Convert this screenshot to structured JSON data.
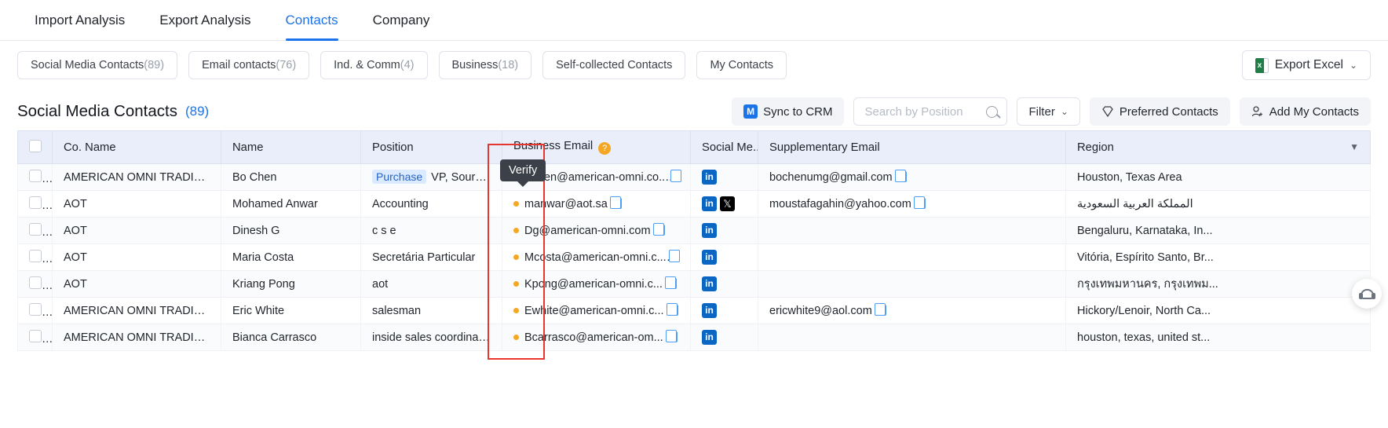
{
  "nav": {
    "tabs": [
      {
        "label": "Import Analysis",
        "active": false
      },
      {
        "label": "Export Analysis",
        "active": false
      },
      {
        "label": "Contacts",
        "active": true
      },
      {
        "label": "Company",
        "active": false
      }
    ]
  },
  "chips": [
    {
      "label": "Social Media Contacts",
      "count": "(89)"
    },
    {
      "label": "Email contacts",
      "count": "(76)"
    },
    {
      "label": "Ind. & Comm",
      "count": "(4)"
    },
    {
      "label": "Business",
      "count": "(18)"
    },
    {
      "label": "Self-collected Contacts",
      "count": ""
    },
    {
      "label": "My Contacts",
      "count": ""
    }
  ],
  "export": {
    "label": "Export Excel",
    "caret": "⌄",
    "icon": "excel-icon"
  },
  "section": {
    "title": "Social Media Contacts",
    "count": "(89)"
  },
  "actions": {
    "sync_label": "Sync to CRM",
    "search_placeholder": "Search by Position",
    "search_value": "",
    "filter_label": "Filter",
    "filter_caret": "⌄",
    "preferred_label": "Preferred Contacts",
    "add_label": "Add My Contacts"
  },
  "tooltip": {
    "text": "Verify"
  },
  "table": {
    "columns": [
      "Co. Name",
      "Name",
      "Position",
      "Business Email",
      "Social Me...",
      "Supplementary Email",
      "Region"
    ],
    "rows": [
      {
        "company": "AMERICAN OMNI TRADING",
        "name": "Bo Chen",
        "position_tag": "Purchase",
        "position": "VP, Sourcing an...",
        "email": "Bchen@american-omni.co...",
        "social": [
          "linkedin"
        ],
        "supplementary": "bochenumg@gmail.com",
        "region": "Houston, Texas Area"
      },
      {
        "company": "AOT",
        "name": "Mohamed Anwar",
        "position_tag": "",
        "position": "Accounting",
        "email": "manwar@aot.sa",
        "social": [
          "linkedin",
          "x"
        ],
        "supplementary": "moustafagahin@yahoo.com",
        "region": "المملكة العربية السعودية"
      },
      {
        "company": "AOT",
        "name": "Dinesh G",
        "position_tag": "",
        "position": "c s e",
        "email": "Dg@american-omni.com",
        "social": [
          "linkedin"
        ],
        "supplementary": "",
        "region": "Bengaluru, Karnataka, In..."
      },
      {
        "company": "AOT",
        "name": "Maria Costa",
        "position_tag": "",
        "position": "Secretária Particular",
        "email": "Mcosta@american-omni.c...",
        "social": [
          "linkedin"
        ],
        "supplementary": "",
        "region": "Vitória, Espírito Santo, Br..."
      },
      {
        "company": "AOT",
        "name": "Kriang Pong",
        "position_tag": "",
        "position": "aot",
        "email": "Kpong@american-omni.c...",
        "social": [
          "linkedin"
        ],
        "supplementary": "",
        "region": "กรุงเทพมหานคร, กรุงเทพม..."
      },
      {
        "company": "AMERICAN OMNI TRADING CO",
        "name": "Eric White",
        "position_tag": "",
        "position": "salesman",
        "email": "Ewhite@american-omni.c...",
        "social": [
          "linkedin"
        ],
        "supplementary": "ericwhite9@aol.com",
        "region": "Hickory/Lenoir, North Ca..."
      },
      {
        "company": "AMERICAN OMNI TRADING CO...",
        "name": "Bianca Carrasco",
        "position_tag": "",
        "position": "inside sales coordinator",
        "email": "Bcarrasco@american-om...",
        "social": [
          "linkedin"
        ],
        "supplementary": "",
        "region": "houston, texas, united st..."
      }
    ]
  },
  "colors": {
    "accent": "#1a73e8",
    "header_bg": "#eaeefb",
    "highlight": "#e8362c",
    "linkedin": "#0a66c2",
    "dot": "#f5a623"
  }
}
